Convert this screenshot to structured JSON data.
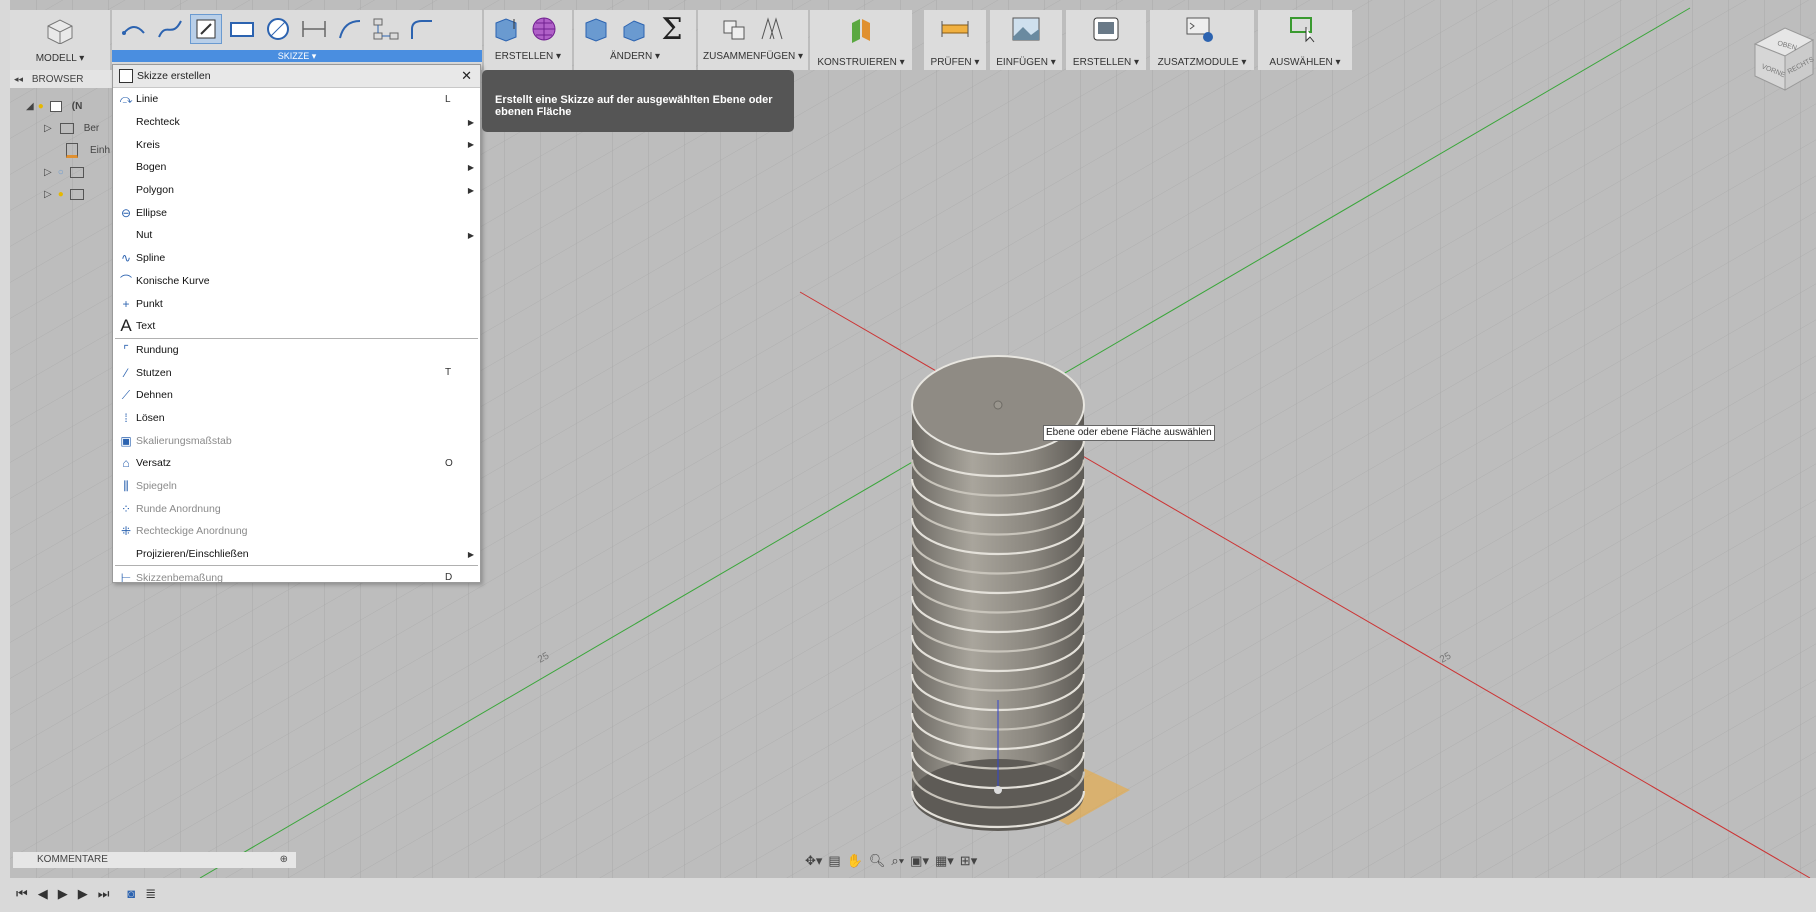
{
  "toolbar": {
    "modell": "MODELL ▾",
    "groups": {
      "skizze": "SKIZZE ▾",
      "erstellen": "ERSTELLEN ▾",
      "aendern": "ÄNDERN ▾",
      "zusammenfuegen": "ZUSAMMENFÜGEN ▾",
      "konstruieren": "KONSTRUIEREN ▾",
      "pruefen": "PRÜFEN ▾",
      "einfuegen": "EINFÜGEN ▾",
      "erstellen2": "ERSTELLEN ▾",
      "zusatzmodule": "ZUSATZMODULE ▾",
      "auswaehlen": "AUSWÄHLEN ▾"
    },
    "sigma": "Σ"
  },
  "browser": {
    "title": "BROWSER",
    "collapse": "◂◂",
    "rows": [
      "(N",
      "Ber",
      "Einh",
      "",
      ""
    ]
  },
  "menu": {
    "header": "Skizze erstellen",
    "close": "✕",
    "items": [
      {
        "label": "Linie",
        "shortcut": "L",
        "icon": "line-icon"
      },
      {
        "label": "Rechteck",
        "arrow": true
      },
      {
        "label": "Kreis",
        "arrow": true
      },
      {
        "label": "Bogen",
        "arrow": true
      },
      {
        "label": "Polygon",
        "arrow": true
      },
      {
        "label": "Ellipse",
        "icon": "ellipse-icon"
      },
      {
        "label": "Nut",
        "arrow": true
      },
      {
        "label": "Spline",
        "icon": "spline-icon"
      },
      {
        "label": "Konische Kurve",
        "icon": "conic-icon"
      },
      {
        "label": "Punkt",
        "icon": "point-icon"
      },
      {
        "label": "Text",
        "icon": "text-icon"
      },
      {
        "sep": true
      },
      {
        "label": "Rundung",
        "icon": "fillet-icon"
      },
      {
        "label": "Stutzen",
        "shortcut": "T",
        "icon": "trim-icon"
      },
      {
        "label": "Dehnen",
        "icon": "extend-icon"
      },
      {
        "label": "Lösen",
        "icon": "break-icon"
      },
      {
        "label": "Skalierungsmaßstab",
        "disabled": true,
        "icon": "scale-icon"
      },
      {
        "label": "Versatz",
        "shortcut": "O",
        "icon": "offset-icon"
      },
      {
        "label": "Spiegeln",
        "disabled": true,
        "icon": "mirror-icon"
      },
      {
        "label": "Runde Anordnung",
        "disabled": true,
        "icon": "circular-pattern-icon"
      },
      {
        "label": "Rechteckige Anordnung",
        "disabled": true,
        "icon": "rect-pattern-icon"
      },
      {
        "label": "Projizieren/Einschließen",
        "arrow": true
      },
      {
        "sep": true
      },
      {
        "label": "Skizzenbemaßung",
        "shortcut": "D",
        "disabled": true,
        "icon": "dimension-icon"
      }
    ]
  },
  "tooltip": "Erstellt eine Skizze auf der ausgewählten Ebene oder ebenen Fläche",
  "hint": "Ebene oder ebene Fläche auswählen",
  "grid_labels": [
    "25",
    "25"
  ],
  "comments": {
    "label": "KOMMENTARE",
    "add": "⊕"
  },
  "viewcube": {
    "top": "OBEN",
    "front": "VORNE",
    "right": "RECHTS"
  },
  "colors": {
    "accent": "#4a8ee0",
    "x_axis": "#cc3333",
    "y_axis": "#3aa63a",
    "z_axis": "#3344cc",
    "plane": "#f0a830"
  }
}
